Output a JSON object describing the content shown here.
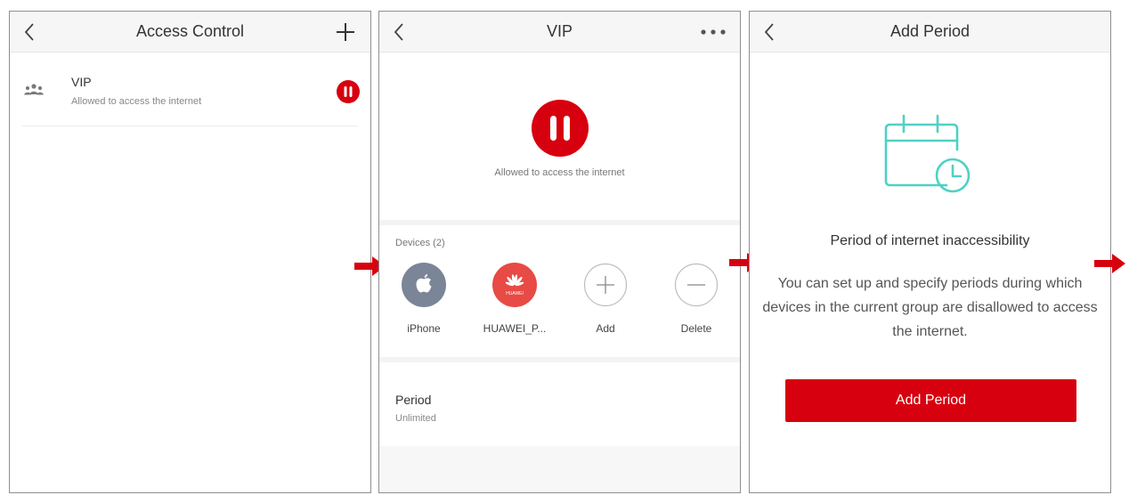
{
  "colors": {
    "brand_red": "#d7000f",
    "teal": "#4fd1c5",
    "apple_gray": "#7a8597",
    "huawei_red": "#e84a45"
  },
  "panel1": {
    "title": "Access Control",
    "group": {
      "name": "VIP",
      "status": "Allowed to access the internet",
      "icon": "group-icon"
    }
  },
  "panel2": {
    "title": "VIP",
    "status": "Allowed to access the internet",
    "devices_label": "Devices (2)",
    "devices": [
      {
        "label": "iPhone",
        "icon": "apple-icon"
      },
      {
        "label": "HUAWEI_P...",
        "icon": "huawei-icon",
        "logo_text": "HUAWEI"
      }
    ],
    "add_label": "Add",
    "delete_label": "Delete",
    "period_title": "Period",
    "period_value": "Unlimited"
  },
  "panel3": {
    "title": "Add Period",
    "heading": "Period of internet inaccessibility",
    "body": "You can set up and specify periods during which devices in the current group are disallowed to access the internet.",
    "button": "Add Period"
  }
}
